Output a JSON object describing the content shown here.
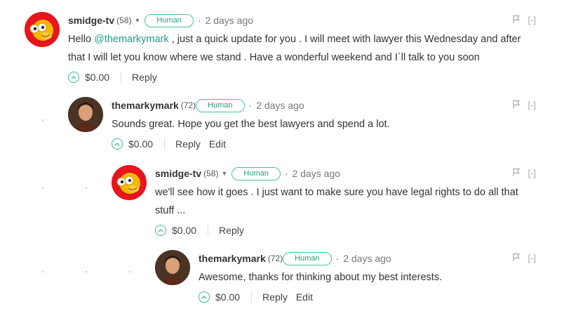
{
  "comments": [
    {
      "author": "smidge-tv",
      "reputation": "(58)",
      "badge": "Human",
      "age": "2 days ago",
      "text_before": "Hello ",
      "mention": "@themarkymark",
      "text_after": " , just a quick update for you . I will meet with lawyer this Wednesday and after that I will let you know where we stand . Have a wonderful weekend and I`ll talk to you soon",
      "payout": "$0.00",
      "reply_label": "Reply",
      "collapse_label": "[-]"
    },
    {
      "author": "themarkymark",
      "reputation": "(72)",
      "badge": "Human",
      "age": "2 days ago",
      "text": "Sounds great. Hope you get the best lawyers and spend a lot.",
      "payout": "$0.00",
      "reply_label": "Reply",
      "edit_label": "Edit",
      "collapse_label": "[-]"
    },
    {
      "author": "smidge-tv",
      "reputation": "(58)",
      "badge": "Human",
      "age": "2 days ago",
      "text": "we'll see how it goes . I just want to make sure you have legal rights to do all that stuff ...",
      "payout": "$0.00",
      "reply_label": "Reply",
      "collapse_label": "[-]"
    },
    {
      "author": "themarkymark",
      "reputation": "(72)",
      "badge": "Human",
      "age": "2 days ago",
      "text": "Awesome, thanks for thinking about my best interests.",
      "payout": "$0.00",
      "reply_label": "Reply",
      "edit_label": "Edit",
      "collapse_label": "[-]"
    }
  ],
  "colors": {
    "accent": "#1fa088",
    "badge_border": "#4bc0a0",
    "avatar_red": "#e8141e"
  },
  "icons": {
    "dropdown": "caret-down-icon",
    "flag": "flag-icon",
    "vote": "upvote-icon"
  }
}
